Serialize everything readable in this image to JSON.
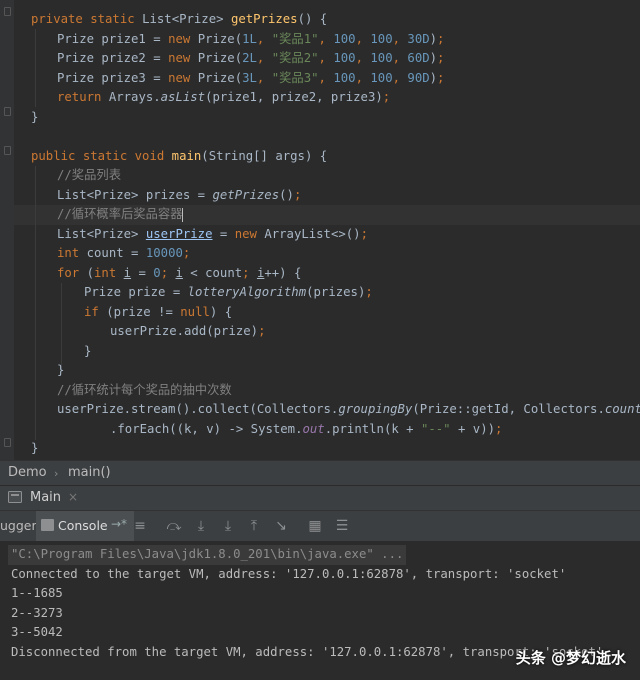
{
  "code": {
    "l1": {
      "kw1": "private static ",
      "type": "List",
      "lt": "<",
      "gen": "Prize",
      "gt": ">",
      "sp": " ",
      "fn": "getPrizes",
      "rest": "() {"
    },
    "l2": {
      "a": "Prize prize1 = ",
      "kw": "new ",
      "b": "Prize(",
      "n1": "1L",
      "c": ", ",
      "s": "\"奖品1\"",
      "d": ", ",
      "n2": "100",
      "e": ", ",
      "n3": "100",
      "f": ", ",
      "n4": "30D",
      "g": ")",
      "sc": ";"
    },
    "l3": {
      "a": "Prize prize2 = ",
      "kw": "new ",
      "b": "Prize(",
      "n1": "2L",
      "c": ", ",
      "s": "\"奖品2\"",
      "d": ", ",
      "n2": "100",
      "e": ", ",
      "n3": "100",
      "f": ", ",
      "n4": "60D",
      "g": ")",
      "sc": ";"
    },
    "l4": {
      "a": "Prize prize3 = ",
      "kw": "new ",
      "b": "Prize(",
      "n1": "3L",
      "c": ", ",
      "s": "\"奖品3\"",
      "d": ", ",
      "n2": "100",
      "e": ", ",
      "n3": "100",
      "f": ", ",
      "n4": "90D",
      "g": ")",
      "sc": ";"
    },
    "l5": {
      "kw": "return ",
      "a": "Arrays.",
      "m": "asList",
      "b": "(prize1, prize2, prize3)",
      "sc": ";"
    },
    "l6": {
      "a": "}"
    },
    "l7": {
      "kw": "public static void ",
      "fn": "main",
      "a": "(String[] args) {"
    },
    "l8": {
      "cm": "//奖品列表"
    },
    "l9": {
      "a": "List<Prize> prizes = ",
      "m": "getPrizes",
      "b": "()",
      "sc": ";"
    },
    "l10": {
      "cm": "//循环概率后奖品容器"
    },
    "l11": {
      "a": "List<Prize> ",
      "v": "userPrize",
      "b": " = ",
      "kw": "new ",
      "c": "ArrayList<>()",
      "sc": ";"
    },
    "l12": {
      "kw": "int ",
      "a": "count = ",
      "n": "10000",
      "sc": ";"
    },
    "l13": {
      "kw": "for ",
      "a": "(",
      "kw2": "int ",
      "i1": "i",
      "b": " = ",
      "n": "0",
      "sc1": "; ",
      "i2": "i",
      "c": " < count",
      "sc2": "; ",
      "i3": "i",
      "d": "++) {"
    },
    "l14": {
      "a": "Prize prize = ",
      "m": "lotteryAlgorithm",
      "b": "(prizes)",
      "sc": ";"
    },
    "l15": {
      "kw": "if ",
      "a": "(prize != ",
      "kw2": "null",
      "b": ") {"
    },
    "l16": {
      "a": "userPrize.add(prize)",
      "sc": ";"
    },
    "l17": {
      "a": "}"
    },
    "l18": {
      "a": "}"
    },
    "l19": {
      "cm": "//循环统计每个奖品的抽中次数"
    },
    "l20": {
      "a": "userPrize.stream().collect(Collectors.",
      "m": "groupingBy",
      "b": "(Prize::getId, Collectors.",
      "m2": "counting",
      "c": "()))"
    },
    "l21": {
      "a": ".forEach((k, v) -> System.",
      "f": "out",
      "b": ".println(k + ",
      "s": "\"--\"",
      "c": " + v))",
      "sc": ";"
    },
    "l22": {
      "a": "}"
    }
  },
  "breadcrumb": {
    "class": "Demo",
    "method": "main()"
  },
  "run_tab": {
    "label": "Main"
  },
  "toolbar": {
    "debugger": "ugger",
    "console": "Console"
  },
  "console": {
    "cmd": "\"C:\\Program Files\\Java\\jdk1.8.0_201\\bin\\java.exe\" ...",
    "connected": "Connected to the target VM, address: '127.0.0.1:62878', transport: 'socket'",
    "r1": "1--1685",
    "r2": "2--3273",
    "r3": "3--5042",
    "disconnected": "Disconnected from the target VM, address: '127.0.0.1:62878', transport: 'socket'"
  },
  "watermark": "头条 @梦幻逝水"
}
